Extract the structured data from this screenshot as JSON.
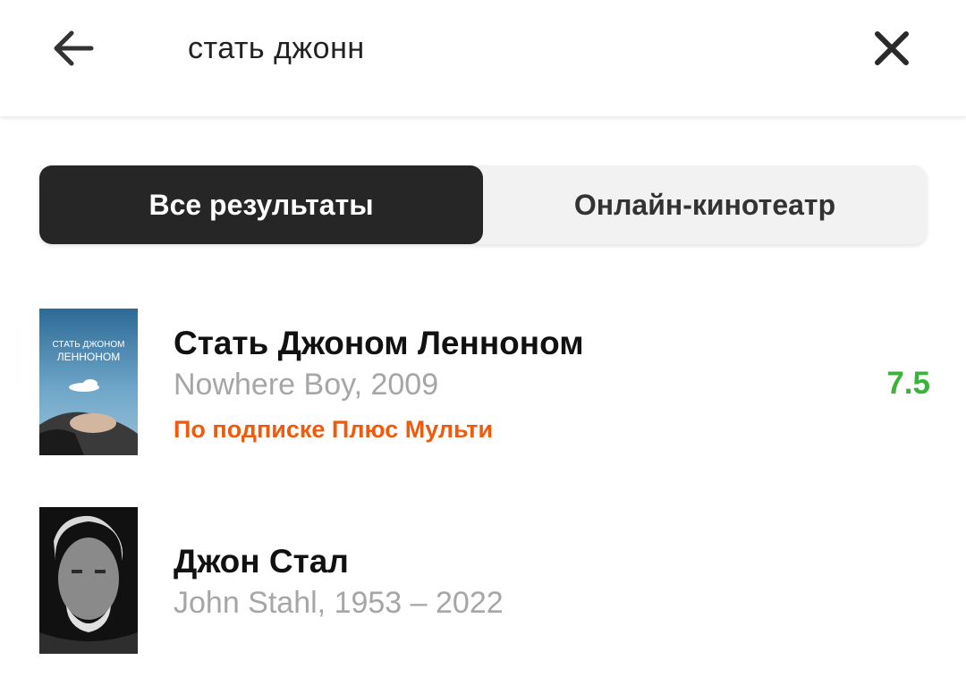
{
  "search": {
    "query": "стать джонн"
  },
  "tabs": [
    {
      "label": "Все результаты",
      "active": true
    },
    {
      "label": "Онлайн-кинотеатр",
      "active": false
    }
  ],
  "results": [
    {
      "title": "Стать Джоном Ленноном",
      "subtitle": "Nowhere Boy, 2009",
      "subscription": "По подписке Плюс Мульти",
      "rating": "7.5",
      "poster_text": [
        "СТАТЬ ДЖОНОМ",
        "ЛЕННОНОМ"
      ]
    },
    {
      "title": "Джон Стал",
      "subtitle": "John Stahl, 1953 – 2022"
    }
  ],
  "colors": {
    "accent_orange": "#f05a0a",
    "rating_green": "#3bb33b",
    "active_tab": "#262626"
  },
  "icons": {
    "back": "arrow-left-icon",
    "clear": "close-icon"
  }
}
